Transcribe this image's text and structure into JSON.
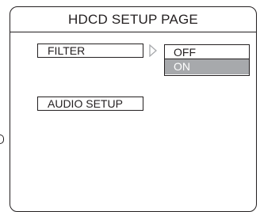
{
  "screen": {
    "title": "HDCD SETUP PAGE"
  },
  "menu": {
    "items": [
      {
        "label": "FILTER"
      },
      {
        "label": "AUDIO SETUP"
      }
    ]
  },
  "submenu": {
    "options": [
      {
        "label": "OFF",
        "selected": false
      },
      {
        "label": "ON",
        "selected": true
      }
    ]
  },
  "icons": {
    "submenu_arrow": "right-triangle-icon"
  },
  "colors": {
    "frame": "#231f20",
    "highlight_bg": "#a7a9ac",
    "highlight_text": "#ffffff",
    "background": "#ffffff"
  }
}
